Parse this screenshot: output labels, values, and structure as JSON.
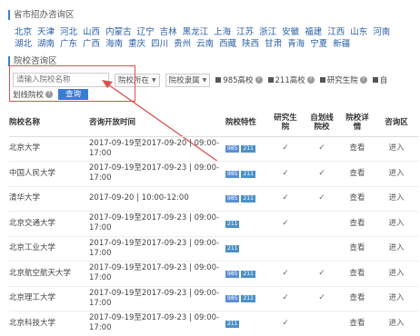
{
  "province_section_title": "省市招办咨询区",
  "provinces_row1": [
    "北京",
    "天津",
    "河北",
    "山西",
    "内蒙古",
    "辽宁",
    "吉林",
    "黑龙江",
    "上海",
    "江苏",
    "浙江",
    "安徽",
    "福建",
    "江西",
    "山东",
    "河南"
  ],
  "provinces_row2": [
    "湖北",
    "湖南",
    "广东",
    "广西",
    "海南",
    "重庆",
    "四川",
    "贵州",
    "云南",
    "西藏",
    "陕西",
    "甘肃",
    "青海",
    "宁夏",
    "新疆"
  ],
  "school_section_title": "院校咨询区",
  "search": {
    "placeholder": "请输入院校名称"
  },
  "filters": {
    "location": "院校所在",
    "affiliation": "院校隶属"
  },
  "checkboxes": {
    "c985": "985高校",
    "c211": "211高校",
    "research": "研究生院",
    "self_row1": "自",
    "self_row2": "划线院校"
  },
  "query_button": "查询",
  "table": {
    "headers": {
      "name": "院校名称",
      "time": "咨询开放时间",
      "feature": "院校特性",
      "grad_row1": "研究生",
      "grad_row2": "院",
      "self_row1": "自划线",
      "self_row2": "院校",
      "detail_row1": "院校详",
      "detail_row2": "情",
      "zone": "咨询区"
    },
    "rows": [
      {
        "name": "北京大学",
        "time1": "2017-09-19至2017-09-20 | 09:00-",
        "time2": "17:00",
        "b985": "985",
        "b211": "211",
        "grad": "✓",
        "self": "✓",
        "detail": "查看",
        "zone": "进入"
      },
      {
        "name": "中国人民大学",
        "time1": "2017-09-19至2017-09-23 | 09:00-",
        "time2": "17:00",
        "b985": "985",
        "b211": "211",
        "grad": "✓",
        "self": "✓",
        "detail": "查看",
        "zone": "进入"
      },
      {
        "name": "清华大学",
        "time1": "2017-09-20 | 10:00-12:00",
        "time2": "",
        "b985": "985",
        "b211": "211",
        "grad": "✓",
        "self": "✓",
        "detail": "查看",
        "zone": "进入"
      },
      {
        "name": "北京交通大学",
        "time1": "2017-09-19至2017-09-23 | 09:00-",
        "time2": "17:00",
        "b985": "",
        "b211": "211",
        "grad": "✓",
        "self": "",
        "detail": "查看",
        "zone": "进入"
      },
      {
        "name": "北京工业大学",
        "time1": "2017-09-19至2017-09-23 | 09:00-",
        "time2": "17:00",
        "b985": "",
        "b211": "211",
        "grad": "",
        "self": "",
        "detail": "查看",
        "zone": "进入"
      },
      {
        "name": "北京航空航天大学",
        "time1": "2017-09-19至2017-09-23 | 09:00-",
        "time2": "17:00",
        "b985": "985",
        "b211": "211",
        "grad": "✓",
        "self": "✓",
        "detail": "查看",
        "zone": "进入"
      },
      {
        "name": "北京理工大学",
        "time1": "2017-09-19至2017-09-23 | 09:00-",
        "time2": "17:00",
        "b985": "985",
        "b211": "211",
        "grad": "✓",
        "self": "✓",
        "detail": "查看",
        "zone": "进入"
      },
      {
        "name": "北京科技大学",
        "time1": "2017-09-19至2017-09-23 | 09:00-",
        "time2": "17:00",
        "b985": "",
        "b211": "211",
        "grad": "✓",
        "self": "",
        "detail": "查看",
        "zone": "进入"
      }
    ]
  },
  "colors": {
    "accent": "#3a7bd5",
    "annotation": "#d9534f",
    "link": "#2b5fa8"
  }
}
